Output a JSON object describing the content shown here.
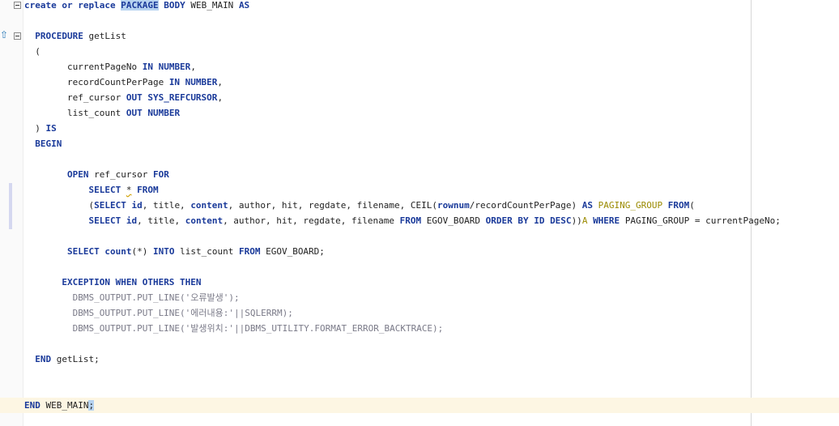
{
  "editor": {
    "lines": [
      [
        [
          "kw",
          "create or replace "
        ],
        [
          "kw hl",
          "PACKAGE"
        ],
        [
          "kw",
          " BODY "
        ],
        [
          "id",
          "WEB_MAIN "
        ],
        [
          "kw",
          "AS"
        ]
      ],
      [],
      [
        [
          "id",
          "  "
        ],
        [
          "kw",
          "PROCEDURE "
        ],
        [
          "id",
          "getList"
        ]
      ],
      [
        [
          "id",
          "  ("
        ]
      ],
      [
        [
          "id",
          "        currentPageNo "
        ],
        [
          "kw",
          "IN NUMBER"
        ],
        [
          "id",
          ","
        ]
      ],
      [
        [
          "id",
          "        recordCountPerPage "
        ],
        [
          "kw",
          "IN NUMBER"
        ],
        [
          "id",
          ","
        ]
      ],
      [
        [
          "id",
          "        ref_cursor "
        ],
        [
          "kw",
          "OUT SYS_REFCURSOR"
        ],
        [
          "id",
          ","
        ]
      ],
      [
        [
          "id",
          "        list_count "
        ],
        [
          "kw",
          "OUT NUMBER"
        ]
      ],
      [
        [
          "id",
          "  ) "
        ],
        [
          "kw",
          "IS"
        ]
      ],
      [
        [
          "id",
          "  "
        ],
        [
          "kw",
          "BEGIN"
        ]
      ],
      [],
      [
        [
          "id",
          "        "
        ],
        [
          "kw",
          "OPEN "
        ],
        [
          "id",
          "ref_cursor "
        ],
        [
          "kw",
          "FOR"
        ]
      ],
      [
        [
          "id",
          "            "
        ],
        [
          "kw",
          "SELECT "
        ],
        [
          "squig",
          "*"
        ],
        [
          "id",
          " "
        ],
        [
          "kw",
          "FROM"
        ]
      ],
      [
        [
          "id",
          "            ("
        ],
        [
          "kw",
          "SELECT "
        ],
        [
          "kw",
          "id"
        ],
        [
          "id",
          ", title, "
        ],
        [
          "kw",
          "content"
        ],
        [
          "id",
          ", author, hit, regdate, filename, CEIL("
        ],
        [
          "kw",
          "rownum"
        ],
        [
          "id",
          "/recordCountPerPage) "
        ],
        [
          "kw",
          "AS "
        ],
        [
          "gold",
          "PAGING_GROUP "
        ],
        [
          "kw",
          "FROM"
        ],
        [
          "id",
          "("
        ]
      ],
      [
        [
          "id",
          "            "
        ],
        [
          "kw",
          "SELECT "
        ],
        [
          "kw",
          "id"
        ],
        [
          "id",
          ", title, "
        ],
        [
          "kw",
          "content"
        ],
        [
          "id",
          ", author, hit, regdate, filename "
        ],
        [
          "kw",
          "FROM "
        ],
        [
          "id",
          "EGOV_BOARD "
        ],
        [
          "kw",
          "ORDER BY ID DESC"
        ],
        [
          "id",
          "))"
        ],
        [
          "gold",
          "A "
        ],
        [
          "kw",
          "WHERE "
        ],
        [
          "id",
          "PAGING_GROUP = currentPageNo;"
        ]
      ],
      [],
      [
        [
          "id",
          "        "
        ],
        [
          "kw",
          "SELECT "
        ],
        [
          "kw",
          "count"
        ],
        [
          "id",
          "(*) "
        ],
        [
          "kw",
          "INTO "
        ],
        [
          "id",
          "list_count "
        ],
        [
          "kw",
          "FROM "
        ],
        [
          "id",
          "EGOV_BOARD;"
        ]
      ],
      [],
      [
        [
          "id",
          "       "
        ],
        [
          "kw",
          "EXCEPTION WHEN OTHERS THEN"
        ]
      ],
      [
        [
          "gray",
          "         DBMS_OUTPUT.PUT_LINE('오류발생');"
        ]
      ],
      [
        [
          "gray",
          "         DBMS_OUTPUT.PUT_LINE('에러내용:'||SQLERRM);"
        ]
      ],
      [
        [
          "gray",
          "         DBMS_OUTPUT.PUT_LINE('발생위치:'||DBMS_UTILITY.FORMAT_ERROR_BACKTRACE);"
        ]
      ],
      [],
      [
        [
          "id",
          "  "
        ],
        [
          "kw",
          "END "
        ],
        [
          "id",
          "getList;"
        ]
      ],
      [],
      [],
      [
        [
          "kw",
          "END "
        ],
        [
          "id",
          "WEB_MAIN"
        ],
        [
          "hl",
          ";"
        ]
      ]
    ]
  }
}
